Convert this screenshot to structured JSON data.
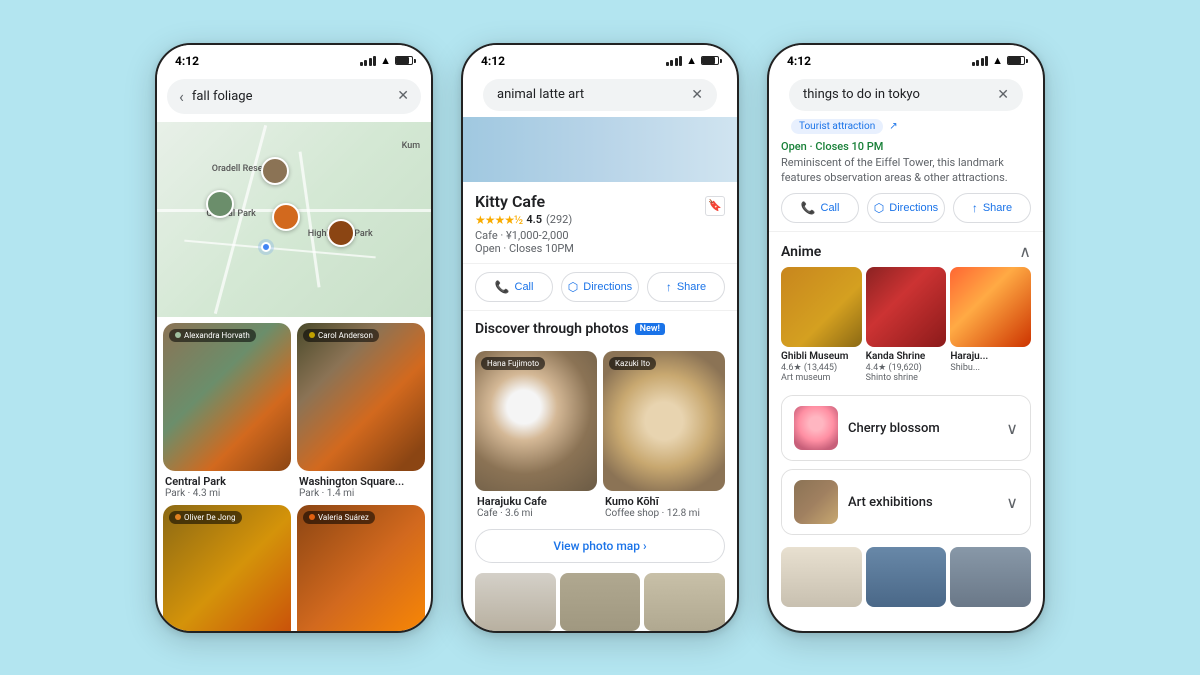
{
  "background_color": "#b3e5f0",
  "phones": [
    {
      "id": "phone1",
      "status_time": "4:12",
      "search_query": "fall foliage",
      "map_labels": [
        "Oradell Reservoir",
        "Central Park",
        "Highbridge Park",
        "Kum"
      ],
      "photos": [
        {
          "contributor": "Alexandra Horvath",
          "contributor_color": "#a0c0a0",
          "name": "Central Park",
          "sub": "Park · 4.3 mi"
        },
        {
          "contributor": "Carol Anderson",
          "contributor_color": "#c0a000",
          "name": "Washington Square...",
          "sub": "Park · 1.4 mi"
        },
        {
          "contributor": "Oliver De Jong",
          "contributor_color": "#e08020",
          "name": "",
          "sub": ""
        },
        {
          "contributor": "Valeria Suárez",
          "contributor_color": "#e06010",
          "name": "",
          "sub": ""
        }
      ]
    },
    {
      "id": "phone2",
      "status_time": "4:12",
      "search_query": "animal latte art",
      "place_name": "Kitty Cafe",
      "rating": "4.5",
      "review_count": "(292)",
      "place_type": "Cafe · ¥1,000-2,000",
      "place_hours": "Open · Closes 10PM",
      "buttons": {
        "call": "Call",
        "directions": "Directions",
        "share": "Share"
      },
      "discover_title": "Discover through photos",
      "new_badge": "New!",
      "latte_photos": [
        {
          "contributor": "Hana Fujimoto",
          "name": "Harajuku Cafe",
          "sub": "Cafe · 3.6 mi"
        },
        {
          "contributor": "Kazuki Ito",
          "name": "Kumo Kōhī",
          "sub": "Coffee shop · 12.8 mi"
        }
      ],
      "view_photo_map": "View photo map ›"
    },
    {
      "id": "phone3",
      "status_time": "4:12",
      "search_query": "things to do in tokyo",
      "tourist_tag": "Tourist attraction",
      "open_status": "Open · Closes 10 PM",
      "place_desc": "Reminiscent of the Eiffel Tower, this landmark features observation areas & other attractions.",
      "buttons": {
        "call": "Call",
        "directions": "Directions",
        "share": "Share"
      },
      "sections": [
        {
          "title": "Anime",
          "expanded": true,
          "places": [
            {
              "name": "Ghibli Museum",
              "rating": "4.6",
              "review_count": "(13,445)",
              "type": "Art museum"
            },
            {
              "name": "Kanda Shrine",
              "rating": "4.4",
              "review_count": "(19,620)",
              "type": "Shinto shrine"
            },
            {
              "name": "Haraju...",
              "rating": "",
              "review_count": "",
              "type": "Shibu..."
            }
          ]
        },
        {
          "title": "Cherry blossom",
          "expanded": false
        },
        {
          "title": "Art exhibitions",
          "expanded": false
        }
      ]
    }
  ]
}
